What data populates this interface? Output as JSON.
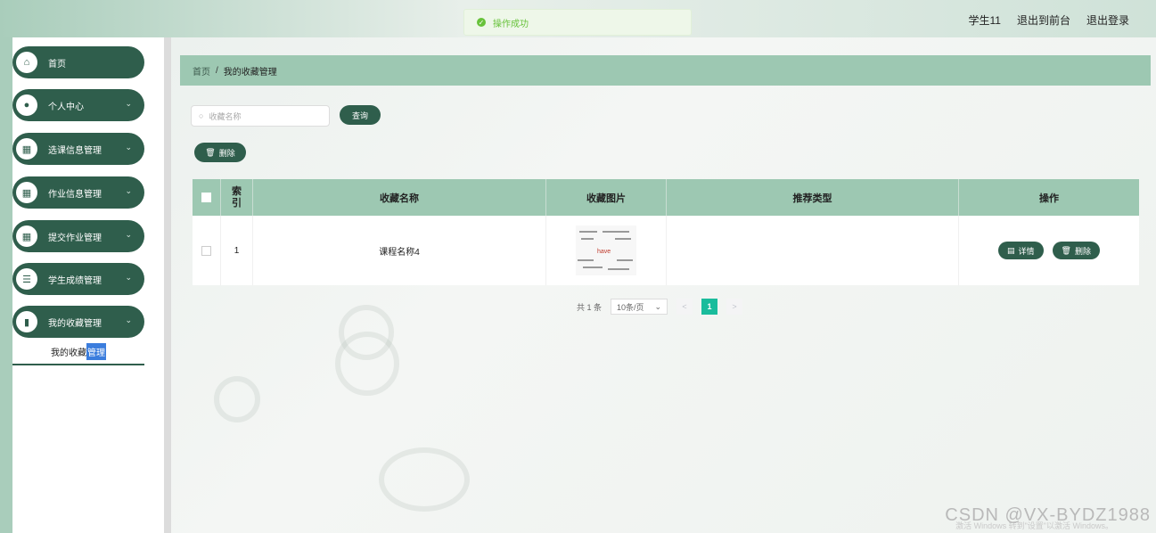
{
  "header": {
    "username": "学生11",
    "back_to_admin": "退出到前台",
    "logout": "退出登录"
  },
  "toast": {
    "message": "操作成功"
  },
  "sidebar": {
    "items": [
      {
        "label": "首页",
        "icon": "home-icon",
        "has_children": false
      },
      {
        "label": "个人中心",
        "icon": "user-icon",
        "has_children": true
      },
      {
        "label": "选课信息管理",
        "icon": "grid-icon",
        "has_children": true
      },
      {
        "label": "作业信息管理",
        "icon": "grid-icon",
        "has_children": true
      },
      {
        "label": "提交作业管理",
        "icon": "grid-icon",
        "has_children": true
      },
      {
        "label": "学生成绩管理",
        "icon": "list-icon",
        "has_children": true
      },
      {
        "label": "我的收藏管理",
        "icon": "bar-chart-icon",
        "has_children": true
      }
    ],
    "submenu": {
      "label_part1": "我的收藏",
      "label_part2": "管理"
    }
  },
  "breadcrumb": {
    "home": "首页",
    "separator": "/",
    "current": "我的收藏管理"
  },
  "search": {
    "placeholder": "收藏名称",
    "button_label": "查询"
  },
  "toolbar": {
    "delete_label": "删除"
  },
  "table": {
    "headers": [
      "索引",
      "收藏名称",
      "收藏图片",
      "推荐类型",
      "操作"
    ],
    "rows": [
      {
        "index": "1",
        "name": "课程名称4",
        "image_text": "have",
        "type": ""
      }
    ],
    "detail_label": "详情",
    "delete_label": "删除"
  },
  "pagination": {
    "total": "共 1 条",
    "page_size": "10条/页",
    "current_page": "1",
    "prev": "<",
    "next": ">"
  },
  "watermark": "CSDN @VX-BYDZ1988",
  "activate_windows": "激活 Windows 转到\"设置\"以激活 Windows。",
  "colors": {
    "primary": "#2f5e4c",
    "header_row": "#9dc8b2",
    "active_page": "#1abc9c",
    "toast": "#67c23a"
  }
}
